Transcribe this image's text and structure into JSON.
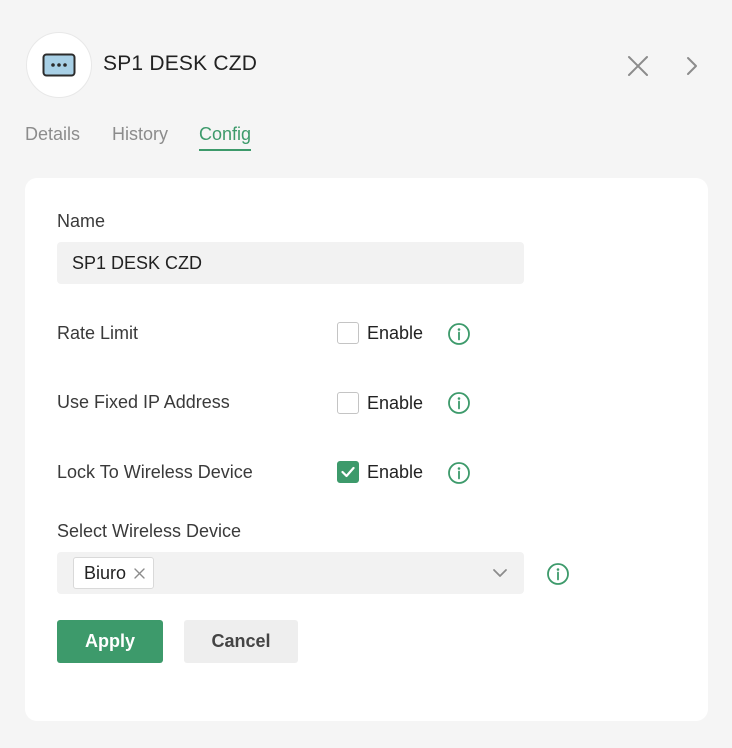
{
  "header": {
    "device_name": "SP1 DESK CZD",
    "device_icon": "ethernet-port-icon",
    "close_icon": "close-icon",
    "next_icon": "chevron-right-icon"
  },
  "tabs": [
    {
      "label": "Details",
      "active": false
    },
    {
      "label": "History",
      "active": false
    },
    {
      "label": "Config",
      "active": true
    }
  ],
  "form": {
    "name_label": "Name",
    "name_value": "SP1 DESK CZD",
    "rate_limit": {
      "label": "Rate Limit",
      "checkbox_label": "Enable",
      "checked": false
    },
    "fixed_ip": {
      "label": "Use Fixed IP Address",
      "checkbox_label": "Enable",
      "checked": false
    },
    "lock_wireless": {
      "label": "Lock To Wireless Device",
      "checkbox_label": "Enable",
      "checked": true
    },
    "select_wireless": {
      "label": "Select Wireless Device",
      "selected_tags": [
        "Biuro"
      ]
    },
    "apply_label": "Apply",
    "cancel_label": "Cancel"
  },
  "colors": {
    "accent": "#3d9a6b",
    "background": "#f5f5f5",
    "card": "#ffffff",
    "input_bg": "#f2f2f2"
  }
}
